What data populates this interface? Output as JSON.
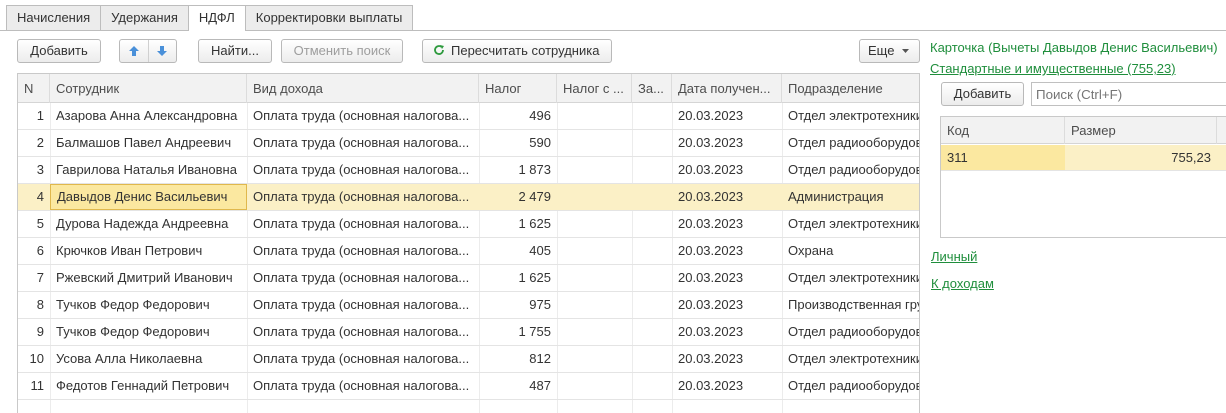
{
  "tabs": [
    "Начисления",
    "Удержания",
    "НДФЛ",
    "Корректировки выплаты"
  ],
  "toolbar": {
    "add": "Добавить",
    "find": "Найти...",
    "cancel_search": "Отменить поиск",
    "recalc": "Пересчитать сотрудника",
    "more": "Еще"
  },
  "table": {
    "columns": [
      "N",
      "Сотрудник",
      "Вид дохода",
      "Налог",
      "Налог с ...",
      "За...",
      "Дата получен...",
      "Подразделение"
    ],
    "rows": [
      {
        "n": "1",
        "employee": "Азарова Анна Александровна",
        "income": "Оплата труда (основная налогова...",
        "tax": "496",
        "tax_with": "",
        "za": "",
        "date": "20.03.2023",
        "dept": "Отдел электротехники"
      },
      {
        "n": "2",
        "employee": "Балмашов Павел Андреевич",
        "income": "Оплата труда (основная налогова...",
        "tax": "590",
        "tax_with": "",
        "za": "",
        "date": "20.03.2023",
        "dept": "Отдел радиооборудования"
      },
      {
        "n": "3",
        "employee": "Гаврилова Наталья Ивановна",
        "income": "Оплата труда (основная налогова...",
        "tax": "1 873",
        "tax_with": "",
        "za": "",
        "date": "20.03.2023",
        "dept": "Отдел радиооборудования"
      },
      {
        "n": "4",
        "employee": "Давыдов Денис Васильевич",
        "income": "Оплата труда (основная налогова...",
        "tax": "2 479",
        "tax_with": "",
        "za": "",
        "date": "20.03.2023",
        "dept": "Администрация"
      },
      {
        "n": "5",
        "employee": "Дурова Надежда Андреевна",
        "income": "Оплата труда (основная налогова...",
        "tax": "1 625",
        "tax_with": "",
        "za": "",
        "date": "20.03.2023",
        "dept": "Отдел электротехники"
      },
      {
        "n": "6",
        "employee": "Крючков Иван Петрович",
        "income": "Оплата труда (основная налогова...",
        "tax": "405",
        "tax_with": "",
        "za": "",
        "date": "20.03.2023",
        "dept": "Охрана"
      },
      {
        "n": "7",
        "employee": "Ржевский Дмитрий Иванович",
        "income": "Оплата труда (основная налогова...",
        "tax": "1 625",
        "tax_with": "",
        "za": "",
        "date": "20.03.2023",
        "dept": "Отдел электротехники"
      },
      {
        "n": "8",
        "employee": "Тучков Федор Федорович",
        "income": "Оплата труда (основная налогова...",
        "tax": "975",
        "tax_with": "",
        "za": "",
        "date": "20.03.2023",
        "dept": "Производственная группа"
      },
      {
        "n": "9",
        "employee": "Тучков Федор Федорович",
        "income": "Оплата труда (основная налогова...",
        "tax": "1 755",
        "tax_with": "",
        "za": "",
        "date": "20.03.2023",
        "dept": "Отдел радиооборудования"
      },
      {
        "n": "10",
        "employee": "Усова Алла Николаевна",
        "income": "Оплата труда (основная налогова...",
        "tax": "812",
        "tax_with": "",
        "za": "",
        "date": "20.03.2023",
        "dept": "Отдел электротехники"
      },
      {
        "n": "11",
        "employee": "Федотов Геннадий Петрович",
        "income": "Оплата труда (основная налогова...",
        "tax": "487",
        "tax_with": "",
        "za": "",
        "date": "20.03.2023",
        "dept": "Отдел радиооборудования"
      }
    ]
  },
  "card": {
    "title": "Карточка (Вычеты Давыдов Денис Васильевич)",
    "standard_link": "Стандартные и имущественные (755,23)",
    "add": "Добавить",
    "search_placeholder": "Поиск (Ctrl+F)",
    "columns": [
      "Код",
      "Размер"
    ],
    "row": {
      "code": "311",
      "size": "755,23"
    },
    "personal_link": "Личный",
    "to_income_link": "К доходам"
  },
  "colors": {
    "accent": "#1f8e3c",
    "selection": "#fbf0c6",
    "arrow": "#4a90d9"
  }
}
